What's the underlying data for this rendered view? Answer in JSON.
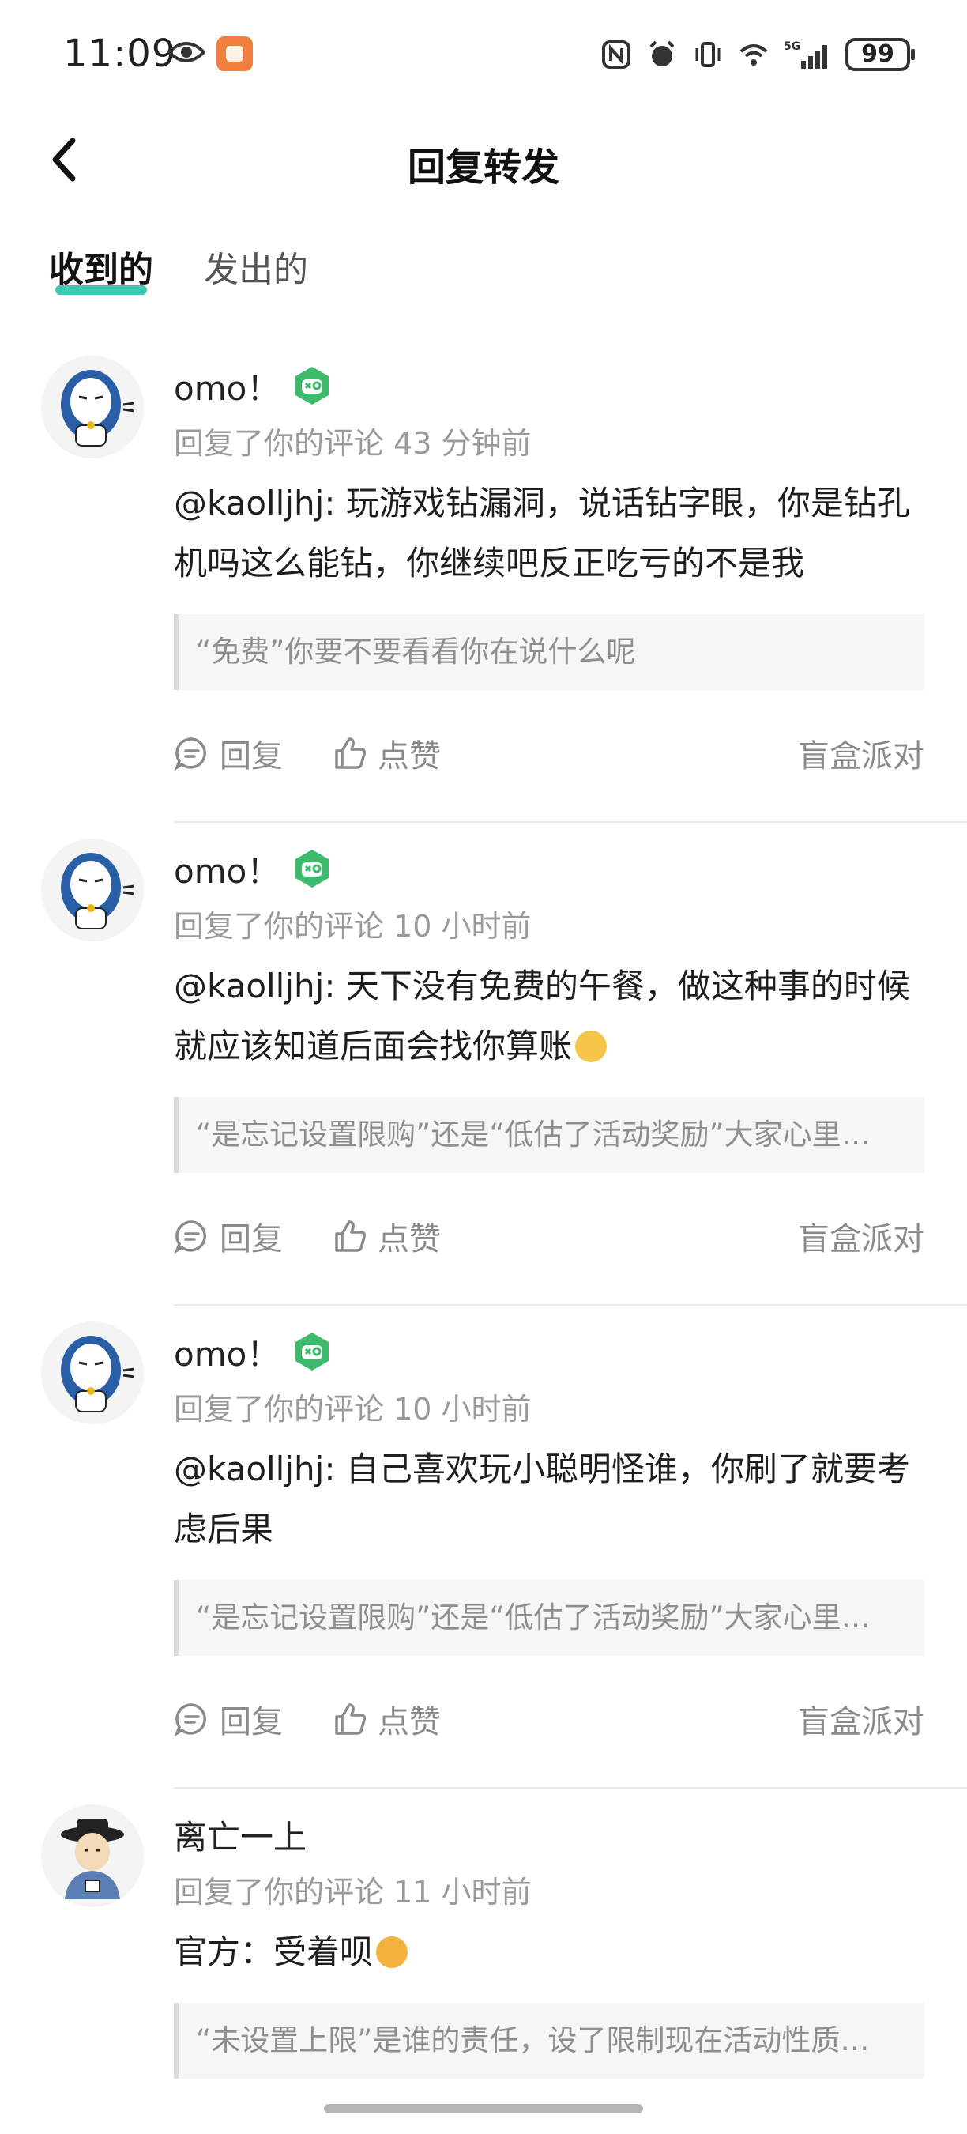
{
  "status_bar": {
    "time": "11:09",
    "battery": "99",
    "icons": [
      "eye-icon",
      "app-notification-icon",
      "nfc-icon",
      "alarm-icon",
      "vibrate-icon",
      "wifi-icon",
      "5g-signal-icon",
      "battery-icon"
    ],
    "network": "5G"
  },
  "header": {
    "title": "回复转发",
    "back_icon": "chevron-left-icon"
  },
  "tabs": [
    {
      "label": "收到的",
      "active": true
    },
    {
      "label": "发出的",
      "active": false
    }
  ],
  "items": [
    {
      "name": "omo！",
      "meta": "回复了你的评论 43 分钟前",
      "text": "@kaolljhj: 玩游戏钻漏洞，说话钻字眼，你是钻孔机吗这么能钻，你继续吧反正吃亏的不是我",
      "quote": "“免费”你要不要看看你在说什么呢",
      "reply_label": "回复",
      "like_label": "点赞",
      "source": "盲盒派对"
    },
    {
      "name": "omo！",
      "meta": "回复了你的评论 10 小时前",
      "text": "@kaolljhj: 天下没有免费的午餐，做这种事的时候就应该知道后面会找你算账",
      "quote": "“是忘记设置限购”还是“低估了活动奖励”大家心里…",
      "reply_label": "回复",
      "like_label": "点赞",
      "source": "盲盒派对"
    },
    {
      "name": "omo！",
      "meta": "回复了你的评论 10 小时前",
      "text": "@kaolljhj: 自己喜欢玩小聪明怪谁，你刷了就要考虑后果",
      "quote": "“是忘记设置限购”还是“低估了活动奖励”大家心里…",
      "reply_label": "回复",
      "like_label": "点赞",
      "source": "盲盒派对"
    },
    {
      "name": "离亡一上",
      "meta": "回复了你的评论 11 小时前",
      "text": "官方：受着呗",
      "quote": "“未设置上限”是谁的责任，设了限制现在活动性质…"
    }
  ],
  "colors": {
    "tab_underline": "#3ec9b0",
    "badge": "#3dbb6c",
    "meta_text": "#9a9a9a"
  }
}
